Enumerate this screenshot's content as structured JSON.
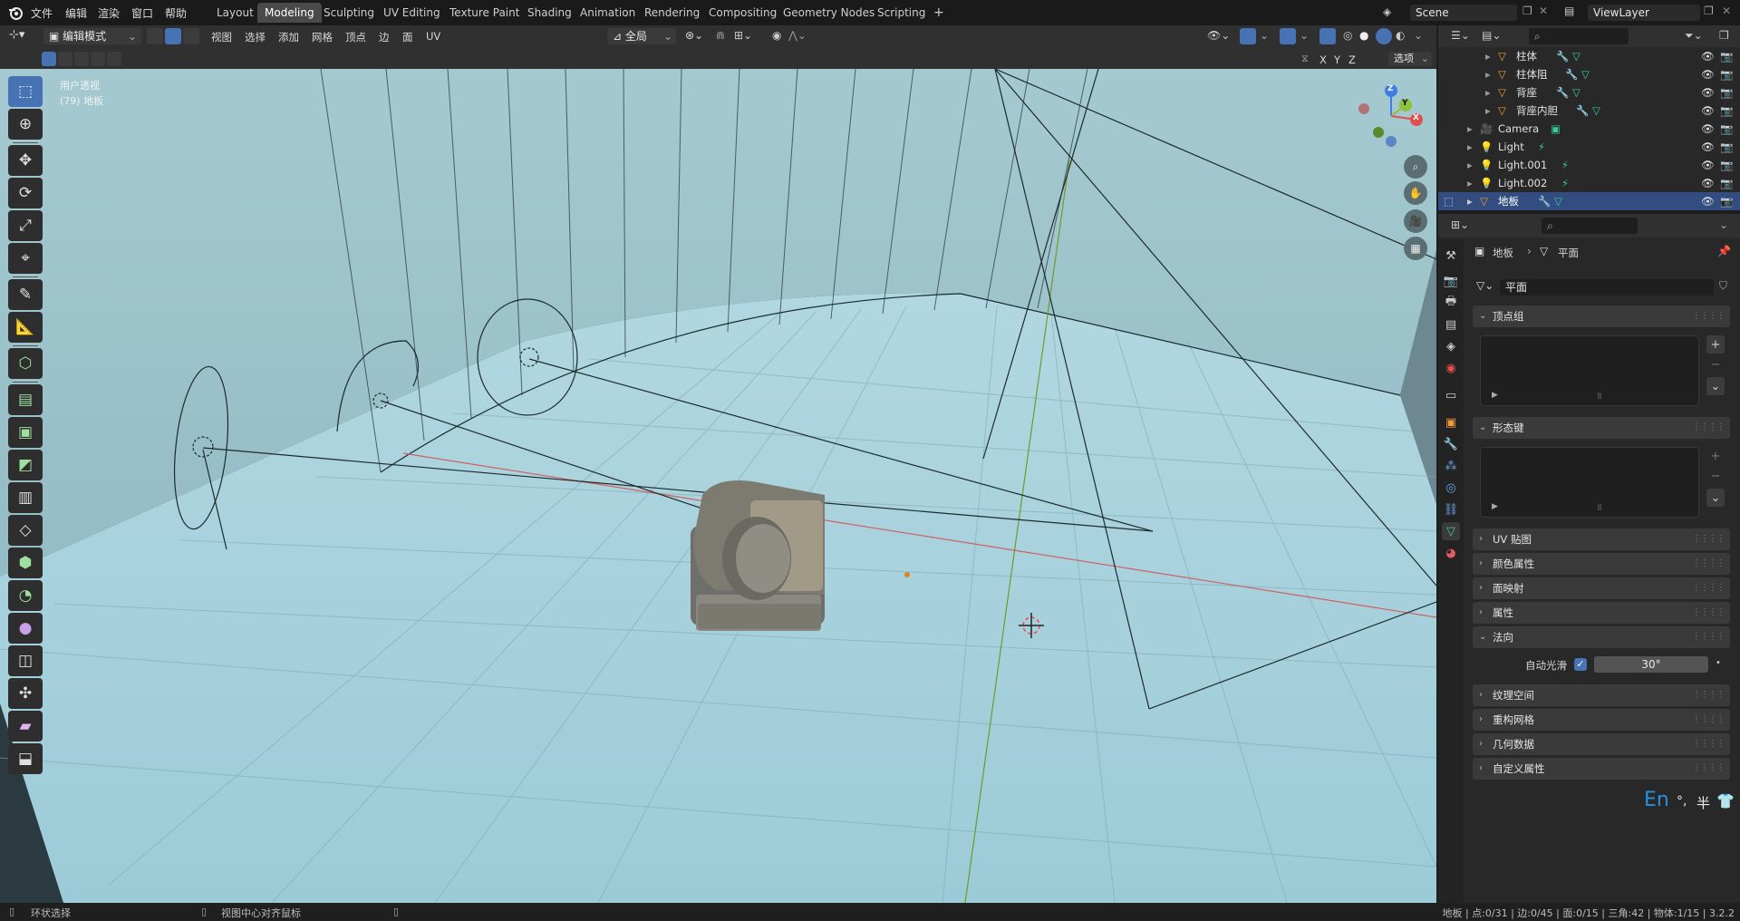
{
  "app": {
    "menus": [
      "文件",
      "编辑",
      "渲染",
      "窗口",
      "帮助"
    ],
    "workspaces": [
      "Layout",
      "Modeling",
      "Sculpting",
      "UV Editing",
      "Texture Paint",
      "Shading",
      "Animation",
      "Rendering",
      "Compositing",
      "Geometry Nodes",
      "Scripting"
    ],
    "active_workspace": "Modeling",
    "add_tab": "+",
    "scene": "Scene",
    "view_layer": "ViewLayer"
  },
  "viewport_header": {
    "mode": "编辑模式",
    "menus": [
      "视图",
      "选择",
      "添加",
      "网格",
      "顶点",
      "边",
      "面",
      "UV"
    ],
    "transform_orientation": "全局",
    "axes": [
      "X",
      "Y",
      "Z"
    ],
    "options": "选项"
  },
  "viewport": {
    "view_name": "用户透视",
    "object_label": "(79) 地板",
    "gizmo_axes": [
      "Z",
      "Y",
      "X"
    ]
  },
  "outliner": {
    "rows": [
      {
        "label": "柱体",
        "kind": "mesh"
      },
      {
        "label": "柱体阻",
        "kind": "mesh"
      },
      {
        "label": "背座",
        "kind": "mesh"
      },
      {
        "label": "背座内胆",
        "kind": "mesh"
      },
      {
        "label": "Camera",
        "kind": "camera"
      },
      {
        "label": "Light",
        "kind": "light"
      },
      {
        "label": "Light.001",
        "kind": "light"
      },
      {
        "label": "Light.002",
        "kind": "light"
      },
      {
        "label": "地板",
        "kind": "mesh"
      }
    ],
    "selected": "地板"
  },
  "properties": {
    "breadcrumb_object": "地板",
    "breadcrumb_data": "平面",
    "mesh_name": "平面",
    "panels": {
      "vertex_groups": "顶点组",
      "shape_keys": "形态键",
      "uv_maps": "UV 贴图",
      "color_attributes": "颜色属性",
      "face_maps": "面映射",
      "attributes": "属性",
      "normals": "法向",
      "texture_space": "纹理空间",
      "remesh": "重构网格",
      "geometry_data": "几何数据",
      "custom_props": "自定义属性"
    },
    "auto_smooth_label": "自动光滑",
    "auto_smooth_angle": "30°",
    "ime": {
      "lang": "En",
      "punct": "°,",
      "width": "半"
    }
  },
  "statusbar": {
    "left": "环状选择",
    "middle": "视图中心对齐鼠标",
    "right": "地板 | 点:0/31 | 边:0/45 | 面:0/15 | 三角:42 | 物体:1/15 | 3.2.2"
  },
  "colors": {
    "accent": "#4772b3",
    "selected_row": "#334d80",
    "sky": "#9ec4cc",
    "floor": "#a7d0db",
    "axis_x": "#e05050",
    "axis_y": "#8fc23a",
    "axis_z": "#3f7ee0",
    "mesh_icon": "#f29a3a",
    "data_icon": "#3cc9a0"
  }
}
